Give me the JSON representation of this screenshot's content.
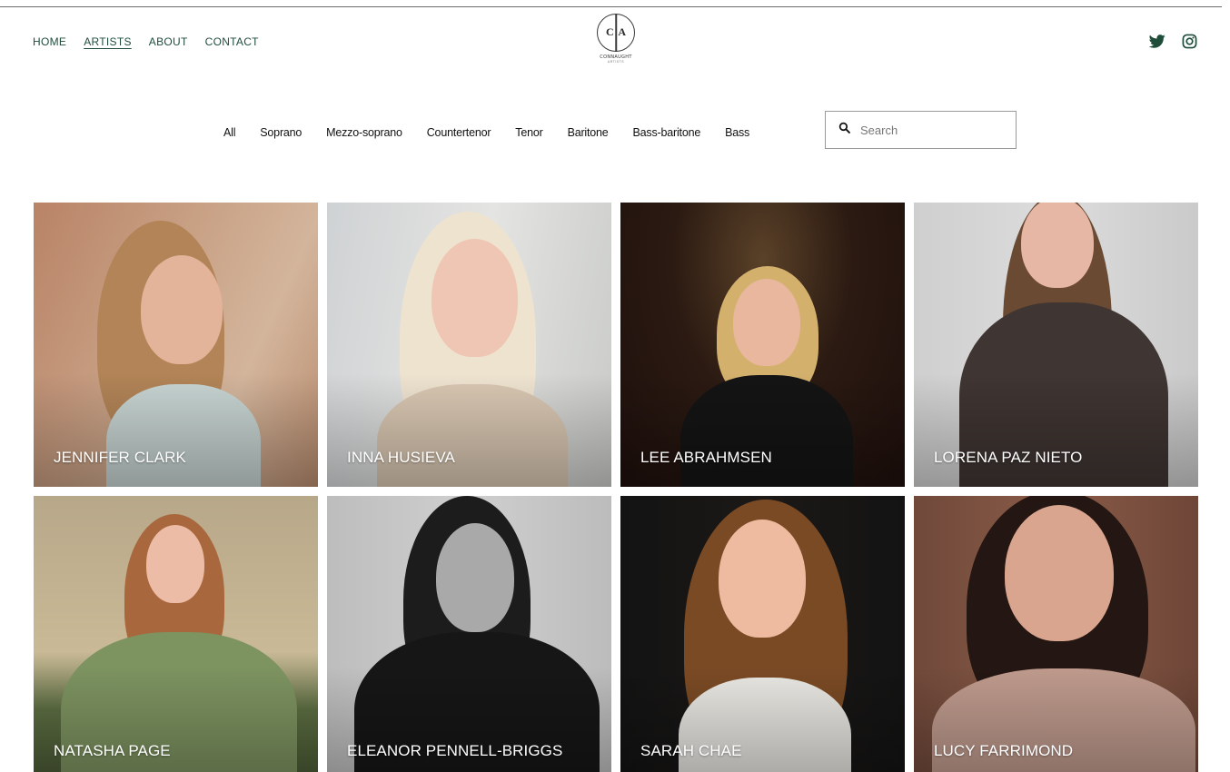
{
  "nav": {
    "home": "HOME",
    "artists": "ARTISTS",
    "about": "ABOUT",
    "contact": "CONTACT"
  },
  "logo": {
    "left_letter": "C",
    "right_letter": "A",
    "wordmark": "CONNAUGHT",
    "sub": "ARTISTS"
  },
  "social": {
    "twitter_icon": "twitter-icon",
    "instagram_icon": "instagram-icon",
    "color": "#1f4d3a"
  },
  "filters": [
    "All",
    "Soprano",
    "Mezzo-soprano",
    "Countertenor",
    "Tenor",
    "Baritone",
    "Bass-baritone",
    "Bass"
  ],
  "search": {
    "placeholder": "Search",
    "icon": "search-icon"
  },
  "artists": [
    {
      "name": "JENNIFER CLARK"
    },
    {
      "name": "INNA HUSIEVA"
    },
    {
      "name": "LEE ABRAHMSEN"
    },
    {
      "name": "LORENA PAZ NIETO"
    },
    {
      "name": "NATASHA PAGE"
    },
    {
      "name": "ELEANOR PENNELL-BRIGGS"
    },
    {
      "name": "SARAH CHAE"
    },
    {
      "name": "LUCY FARRIMOND"
    }
  ]
}
